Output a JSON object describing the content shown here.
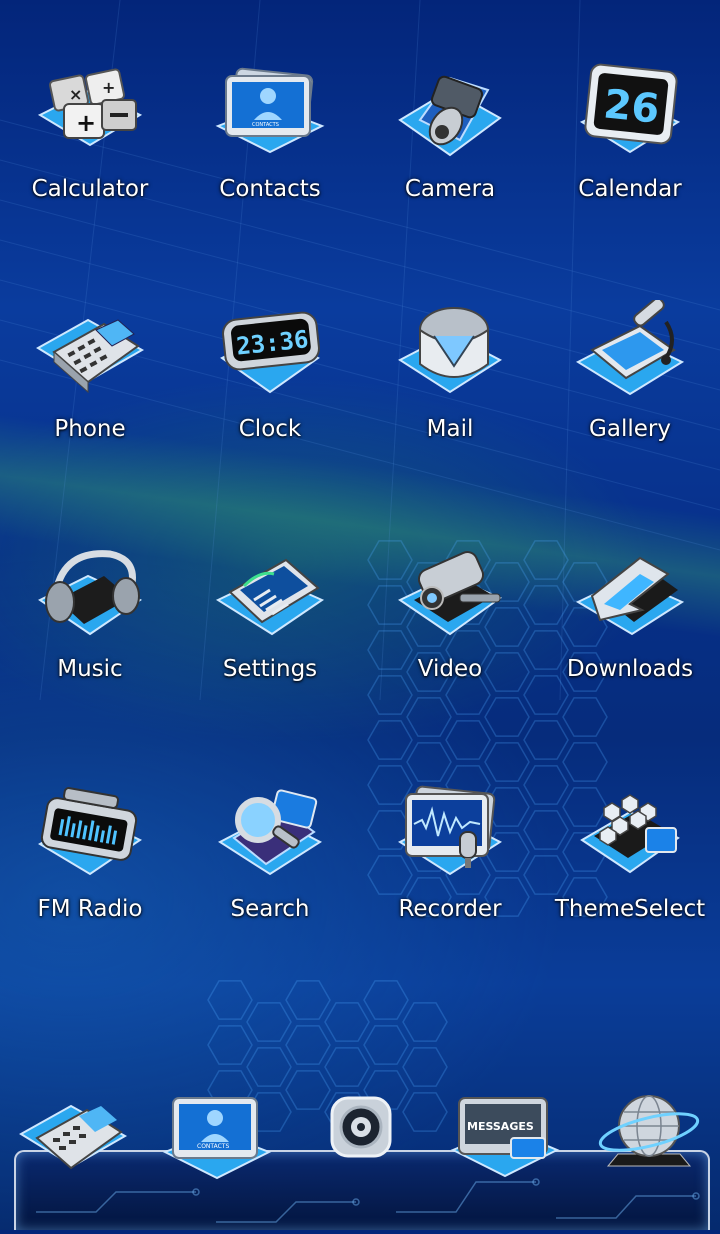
{
  "apps": [
    {
      "label": "Calculator",
      "icon": "calculator-icon"
    },
    {
      "label": "Contacts",
      "icon": "contacts-icon"
    },
    {
      "label": "Camera",
      "icon": "camera-icon"
    },
    {
      "label": "Calendar",
      "icon": "calendar-icon",
      "badge_text": "26"
    },
    {
      "label": "Phone",
      "icon": "phone-icon"
    },
    {
      "label": "Clock",
      "icon": "clock-icon",
      "badge_text": "23:36"
    },
    {
      "label": "Mail",
      "icon": "mail-icon"
    },
    {
      "label": "Gallery",
      "icon": "gallery-icon"
    },
    {
      "label": "Music",
      "icon": "music-icon"
    },
    {
      "label": "Settings",
      "icon": "settings-icon"
    },
    {
      "label": "Video",
      "icon": "video-icon"
    },
    {
      "label": "Downloads",
      "icon": "downloads-icon"
    },
    {
      "label": "FM Radio",
      "icon": "radio-icon"
    },
    {
      "label": "Search",
      "icon": "search-icon"
    },
    {
      "label": "Recorder",
      "icon": "recorder-icon"
    },
    {
      "label": "ThemeSelect",
      "icon": "theme-select-icon"
    }
  ],
  "dock": [
    {
      "icon": "phone-icon"
    },
    {
      "icon": "contacts-icon",
      "caption": "CONTACTS"
    },
    {
      "icon": "app-drawer-icon"
    },
    {
      "icon": "messages-icon",
      "caption": "MESSAGES"
    },
    {
      "icon": "browser-globe-icon"
    }
  ],
  "colors": {
    "accent": "#3fb6ff",
    "background": "#0a3c9e",
    "label": "#ffffff"
  }
}
